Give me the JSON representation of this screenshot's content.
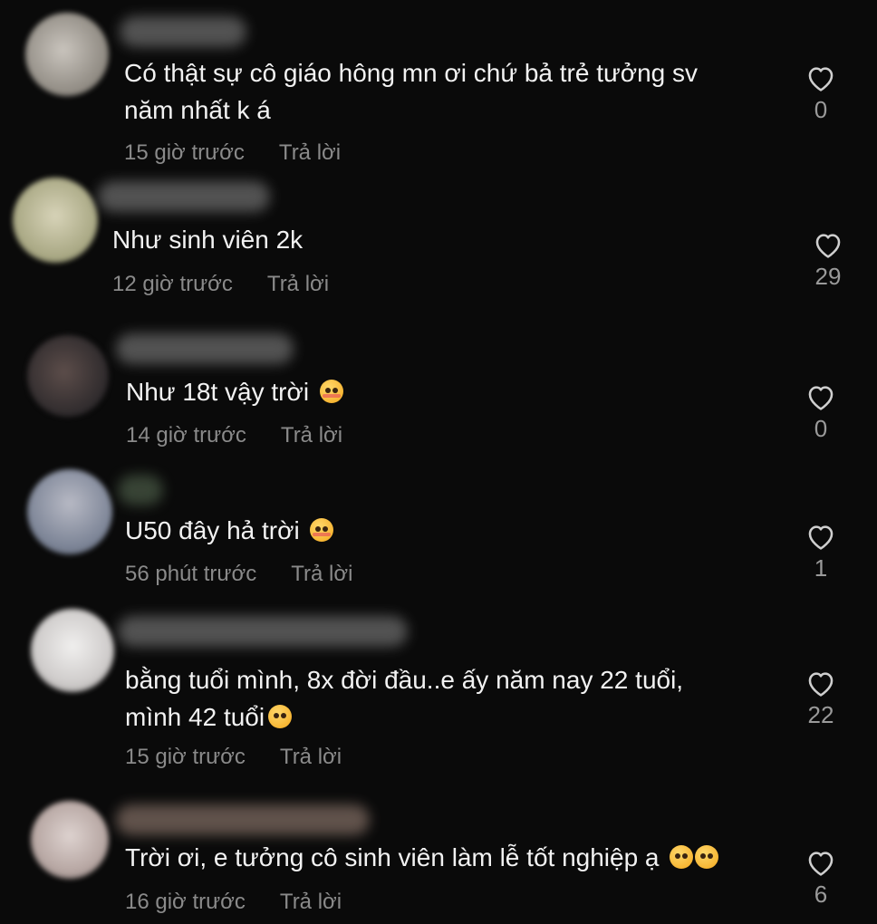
{
  "comments": [
    {
      "text_lines": [
        "Có thật sự cô giáo hông mn ơi chứ bả trẻ tưởng sv",
        "năm nhất k á"
      ],
      "time": "15 giờ trước",
      "reply": "Trả lời",
      "likes": "0"
    },
    {
      "text_lines": [
        "Như sinh viên 2k"
      ],
      "time": "12 giờ trước",
      "reply": "Trả lời",
      "likes": "29"
    },
    {
      "text_lines": [
        "Như 18t vậy trời"
      ],
      "emoji": "smiling-face-with-hearts",
      "time": "14 giờ trước",
      "reply": "Trả lời",
      "likes": "0"
    },
    {
      "text_lines": [
        "U50 đây hả trời"
      ],
      "emoji": "smiling-face-with-hearts",
      "time": "56 phút trước",
      "reply": "Trả lời",
      "likes": "1"
    },
    {
      "text_lines": [
        "bằng tuổi mình, 8x đời đầu..e ấy năm nay 22 tuổi,",
        "mình 42 tuổi"
      ],
      "emoji": "grinning-face",
      "time": "15 giờ trước",
      "reply": "Trả lời",
      "likes": "22"
    },
    {
      "text_lines": [
        "Trời ơi, e tưởng cô sinh viên làm lễ tốt nghiệp ạ"
      ],
      "emoji": "pleading-face",
      "time": "16 giờ trước",
      "reply": "Trả lời",
      "likes": "6"
    }
  ],
  "icons": {
    "like": "heart-outline-icon"
  },
  "colors": {
    "background": "#0a0a0a",
    "text": "#f2f2f2",
    "meta": "#8a8a8a"
  }
}
